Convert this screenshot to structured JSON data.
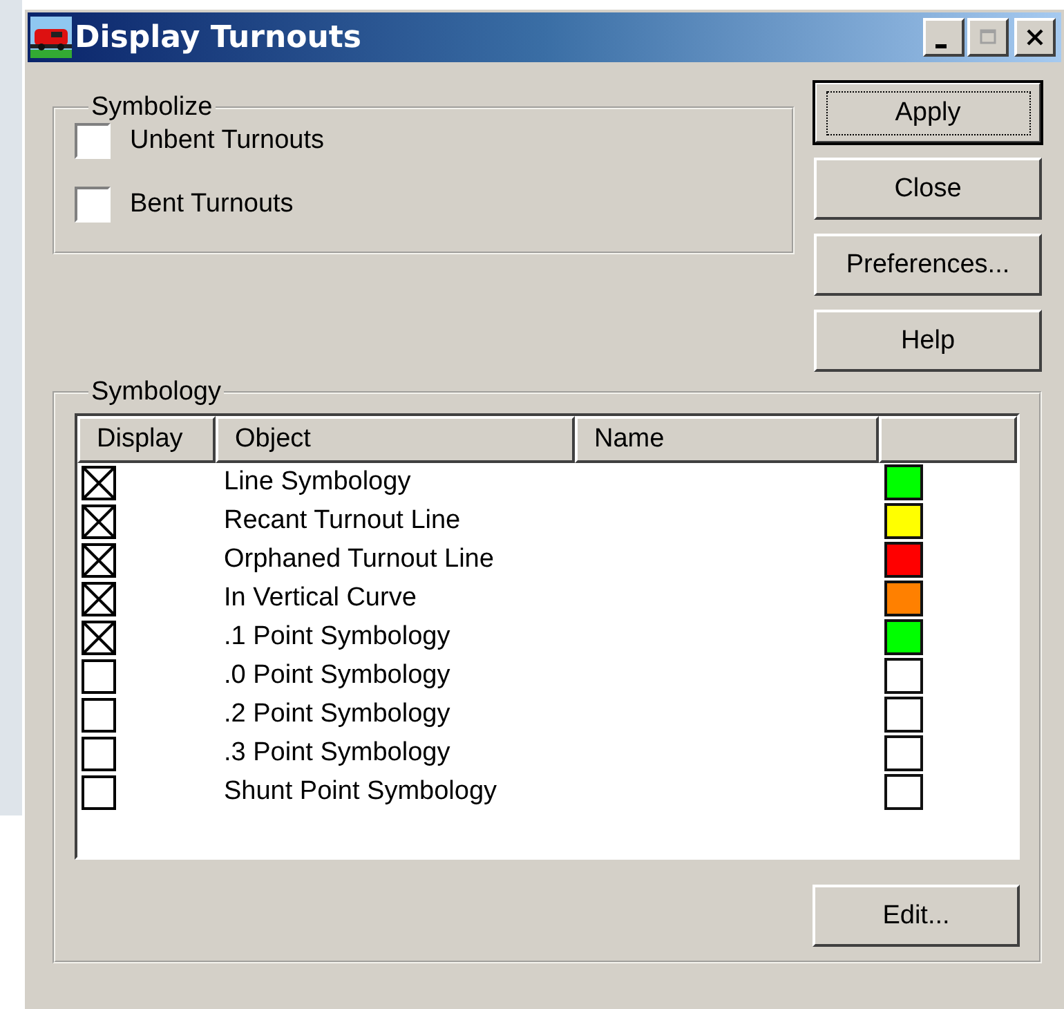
{
  "window": {
    "title": "Display Turnouts"
  },
  "symbolize": {
    "title": "Symbolize",
    "options": [
      {
        "label": "Unbent Turnouts",
        "checked": false
      },
      {
        "label": "Bent Turnouts",
        "checked": false
      }
    ]
  },
  "buttons": [
    {
      "label": "Apply",
      "focused": true
    },
    {
      "label": "Close",
      "focused": false
    },
    {
      "label": "Preferences...",
      "focused": false
    },
    {
      "label": "Help",
      "focused": false
    }
  ],
  "symbology": {
    "title": "Symbology",
    "columns": [
      "Display",
      "Object",
      "Name"
    ],
    "rows": [
      {
        "checked": true,
        "object": "Line Symbology",
        "color": "#00ff00"
      },
      {
        "checked": true,
        "object": "Recant Turnout Line",
        "color": "#ffff00"
      },
      {
        "checked": true,
        "object": "Orphaned Turnout Line",
        "color": "#ff0000"
      },
      {
        "checked": true,
        "object": "In Vertical Curve",
        "color": "#ff8000"
      },
      {
        "checked": true,
        "object": ".1 Point Symbology",
        "color": "#00ff00"
      },
      {
        "checked": false,
        "object": ".0 Point Symbology",
        "color": "#ffffff"
      },
      {
        "checked": false,
        "object": ".2 Point Symbology",
        "color": "#ffffff"
      },
      {
        "checked": false,
        "object": ".3 Point Symbology",
        "color": "#ffffff"
      },
      {
        "checked": false,
        "object": "Shunt Point Symbology",
        "color": "#ffffff"
      }
    ],
    "edit_button": "Edit..."
  }
}
